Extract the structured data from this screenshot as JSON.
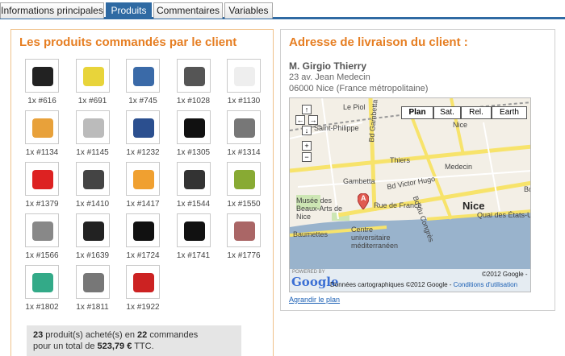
{
  "tabs": [
    {
      "label": "Informations principales",
      "active": false
    },
    {
      "label": "Produits",
      "active": true
    },
    {
      "label": "Commentaires",
      "active": false
    },
    {
      "label": "Variables",
      "active": false
    }
  ],
  "products_panel": {
    "title": "Les produits commandés par le client",
    "items": [
      {
        "label": "1x #616",
        "icon": "black-gift-box-icon"
      },
      {
        "label": "1x #691",
        "icon": "yellow-gum-pack-icon"
      },
      {
        "label": "1x #745",
        "icon": "usb-serial-adapter-icon"
      },
      {
        "label": "1x #1028",
        "icon": "phone-device-icon"
      },
      {
        "label": "1x #1130",
        "icon": "white-remote-icon"
      },
      {
        "label": "1x #1134",
        "icon": "burger-phone-icon"
      },
      {
        "label": "1x #1145",
        "icon": "glasses-gadget-icon"
      },
      {
        "label": "1x #1232",
        "icon": "solar-panel-icon"
      },
      {
        "label": "1x #1305",
        "icon": "black-tshirt-icon"
      },
      {
        "label": "1x #1314",
        "icon": "photo-keychain-icon"
      },
      {
        "label": "1x #1379",
        "icon": "red-box-icon"
      },
      {
        "label": "1x #1410",
        "icon": "cockroach-robot-icon"
      },
      {
        "label": "1x #1417",
        "icon": "figurine-icon"
      },
      {
        "label": "1x #1544",
        "icon": "3d-glasses-icon"
      },
      {
        "label": "1x #1550",
        "icon": "tablet-pile-icon"
      },
      {
        "label": "1x #1566",
        "icon": "keychain-disc-icon"
      },
      {
        "label": "1x #1639",
        "icon": "cap-gadget-icon"
      },
      {
        "label": "1x #1724",
        "icon": "black-tshirt-icon"
      },
      {
        "label": "1x #1741",
        "icon": "black-tshirt-icon"
      },
      {
        "label": "1x #1776",
        "icon": "gun-gadget-icon"
      },
      {
        "label": "1x #1802",
        "icon": "robot-figurine-icon"
      },
      {
        "label": "1x #1811",
        "icon": "cables-icon"
      },
      {
        "label": "1x #1922",
        "icon": "red-mug-icon"
      }
    ],
    "summary": {
      "count": "23",
      "line1_a": " produit(s) acheté(s) en ",
      "orders": "22",
      "line1_b": " commandes",
      "line2_a": "pour un total de ",
      "total": "523,79 €",
      "line2_b": " TTC."
    }
  },
  "address_panel": {
    "title": "Adresse de livraison du client :",
    "name": "M. Girgio Thierry",
    "street": "23 av. Jean Medecin",
    "city": "06000 Nice (France métropolitaine)",
    "map": {
      "types": [
        "Plan",
        "Sat.",
        "Rel.",
        "Earth"
      ],
      "active_type": "Plan",
      "labels": {
        "le_piol": "Le Piol",
        "saint_philippe": "Saint-Philippe",
        "bd_gambetta": "Bd Gambetta",
        "thiers": "Thiers",
        "medecin": "Medecin",
        "nice_small": "Nice",
        "gambetta": "Gambetta",
        "bd_victor_hugo": "Bd Victor Hugo",
        "rue_de_france": "Rue de France",
        "bd_du_congres": "Bd du Congrès",
        "nice": "Nice",
        "musee": "Musée des Beaux-Arts de Nice",
        "baumettes": "Baumettes",
        "centre": "Centre universitaire méditerranéen",
        "quai": "Quai des États-Unis",
        "bd": "Bd",
        "marker": "A"
      },
      "copyright": "©2012 Google -",
      "powered_by": "POWERED BY",
      "google": "Google",
      "footer_text": "Données cartographiques ©2012 Google - ",
      "terms_link": "Conditions d'utilisation"
    },
    "enlarge_link": "Agrandir le plan"
  },
  "colors": {
    "tab_active": "#2f6aa3",
    "title_orange": "#e67e22",
    "panel_border": "#f0c28c"
  }
}
